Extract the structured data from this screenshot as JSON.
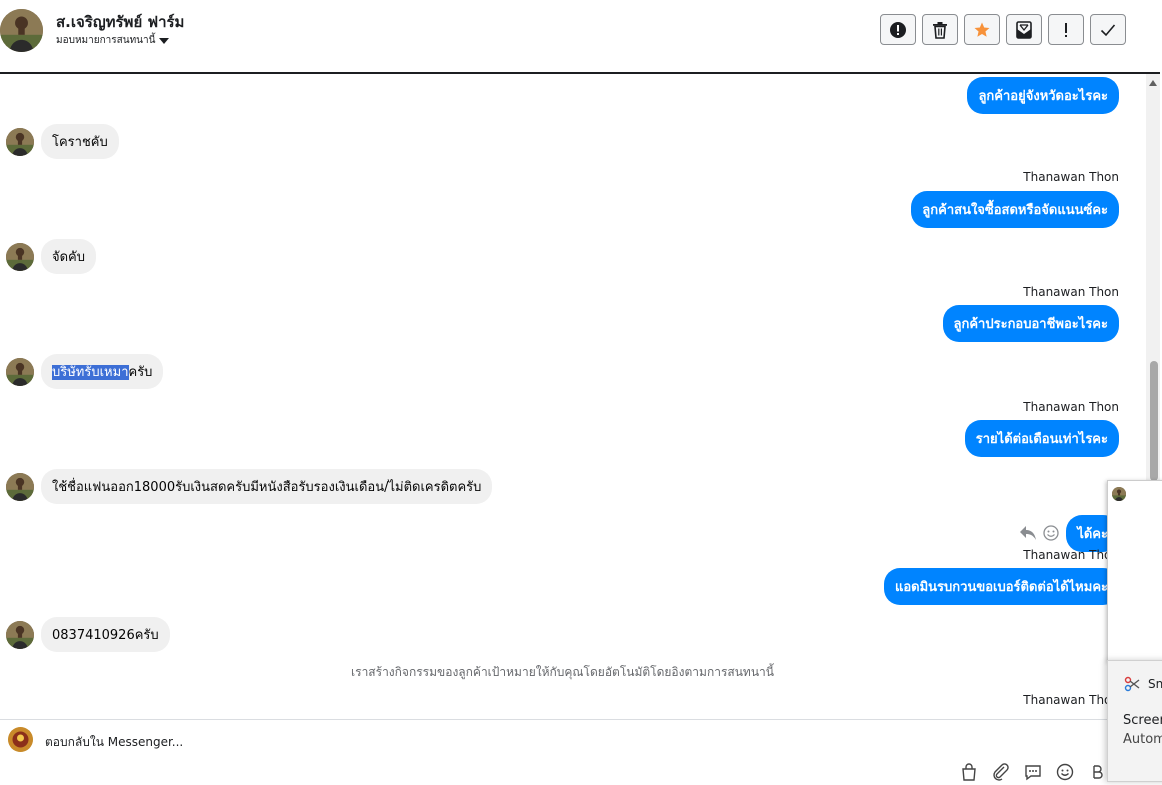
{
  "header": {
    "contact_name": "ส.เจริญทรัพย์ ฟาร์ม",
    "assign_label": "มอบหมายการสนทนานี้"
  },
  "toolbar": {
    "buttons": [
      "alert-icon",
      "trash-icon",
      "star-icon",
      "mark-unread-icon",
      "exclamation-icon",
      "check-icon"
    ],
    "star_color": "#f7923a"
  },
  "thread": {
    "agent_name": "Thanawan Thon",
    "messages": [
      {
        "dir": "out",
        "text": "ลูกค้าอยู่จังหวัดอะไรคะ"
      },
      {
        "dir": "in",
        "text": "โคราชคับ"
      },
      {
        "dir": "out",
        "sender": "Thanawan Thon",
        "text": "ลูกค้าสนใจซื้อสดหรือจัดแนนซ์คะ"
      },
      {
        "dir": "in",
        "text": "จัดคับ"
      },
      {
        "dir": "out",
        "sender": "Thanawan Thon",
        "text": "ลูกค้าประกอบอาชีพอะไรคะ"
      },
      {
        "dir": "in",
        "text_highlighted": "บริษัทรับเหมา",
        "text_rest": "ครับ"
      },
      {
        "dir": "out",
        "sender": "Thanawan Thon",
        "text": "รายได้ต่อเดือนเท่าไรคะ"
      },
      {
        "dir": "in",
        "text": "ใช้ชื่อแฟนออก18000รับเงินสดครับมีหนังสือรับรองเงินเดือน/ไม่ติดเครดิตครับ"
      },
      {
        "dir": "out",
        "text": "ได้คะ"
      },
      {
        "dir": "out",
        "sender": "Thanawan Thon",
        "text": "แอดมินรบกวนขอเบอร์ติดต่อได้ไหมคะ"
      },
      {
        "dir": "in",
        "text": "0837410926ครับ"
      },
      {
        "dir": "out",
        "sender": "Thanawan Thon"
      }
    ],
    "notice": "เราสร้างกิจกรรมของลูกค้าเป้าหมายให้กับคุณโดยอัตโนมัติโดยอิงตามการสนทนานี้"
  },
  "composer": {
    "placeholder": "ตอบกลับใน Messenger..."
  },
  "popup": {
    "snip_title": "Sni",
    "line1": "Screen",
    "line2": "Autom"
  },
  "colors": {
    "outgoing_bubble": "#0084ff",
    "incoming_bubble": "#f0f0f0",
    "highlight": "#3d6fd6"
  }
}
